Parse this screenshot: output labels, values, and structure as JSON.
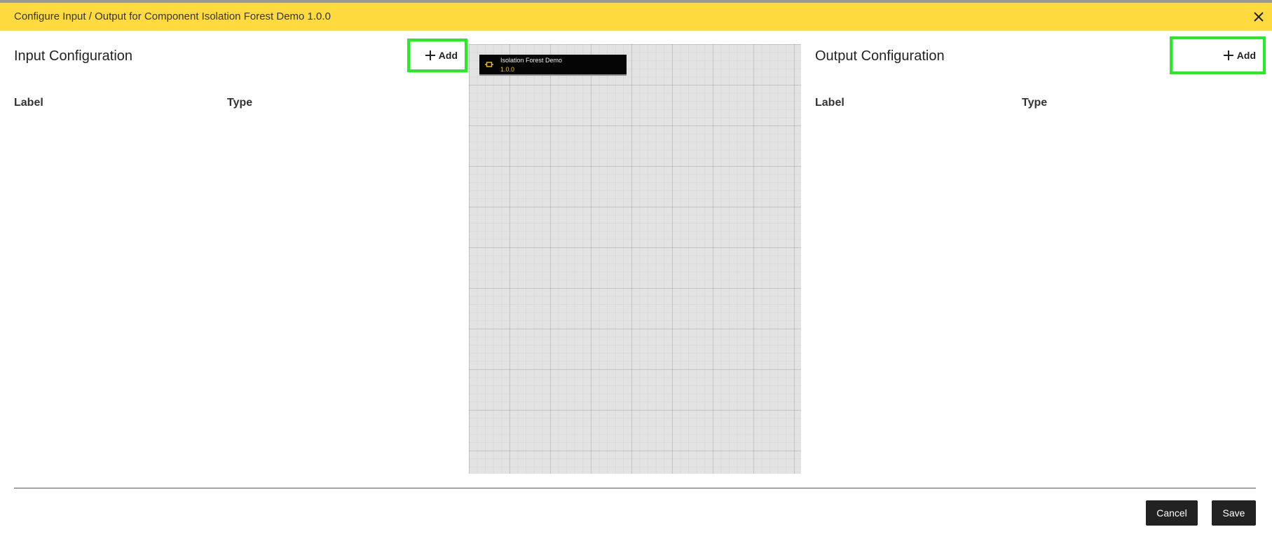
{
  "dialog": {
    "title": "Configure Input / Output for Component Isolation Forest Demo 1.0.0",
    "close_icon": "close-icon",
    "accent_color": "#ffdb3f"
  },
  "input": {
    "title": "Input Configuration",
    "add_label": "Add",
    "columns": [
      "Label",
      "Type"
    ]
  },
  "output": {
    "title": "Output Configuration",
    "add_label": "Add",
    "columns": [
      "Label",
      "Type"
    ]
  },
  "canvas": {
    "node": {
      "name": "Isolation Forest Demo",
      "version": "1.0.0",
      "icon": "component-icon",
      "version_color": "#f2c21b"
    }
  },
  "footer": {
    "cancel_label": "Cancel",
    "save_label": "Save"
  },
  "highlight_color": "#22ee22"
}
